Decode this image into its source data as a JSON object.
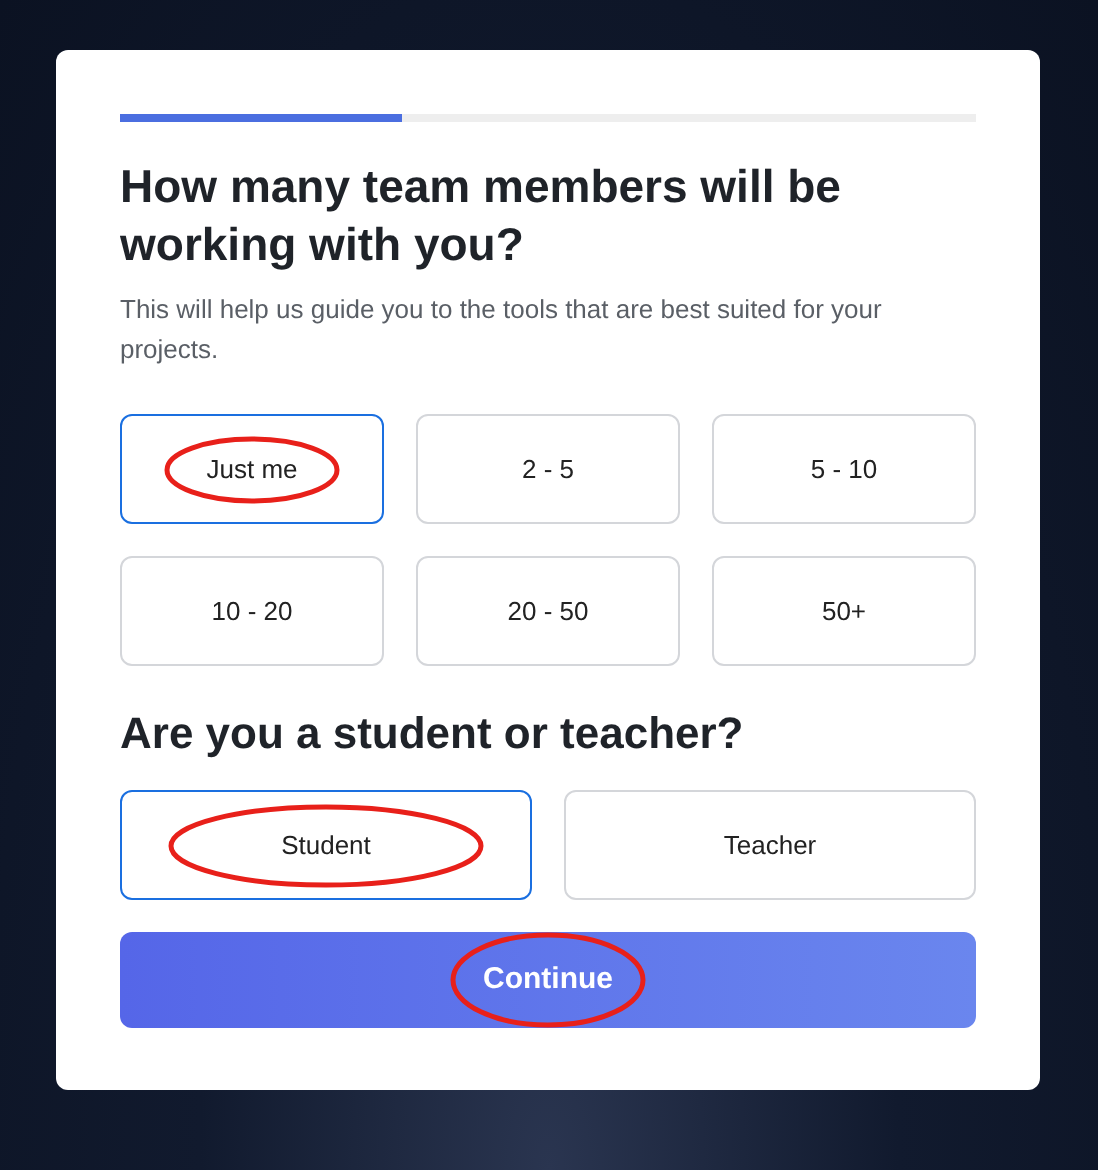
{
  "progress": {
    "level": 0.33
  },
  "question_1": {
    "title": "How many team members will be working with you?",
    "subtitle": "This will help us guide you to the tools that are best suited for your projects.",
    "options": [
      {
        "label": "Just me",
        "selected": true,
        "annotated": true
      },
      {
        "label": "2 - 5",
        "selected": false,
        "annotated": false
      },
      {
        "label": "5 - 10",
        "selected": false,
        "annotated": false
      },
      {
        "label": "10 - 20",
        "selected": false,
        "annotated": false
      },
      {
        "label": "20 - 50",
        "selected": false,
        "annotated": false
      },
      {
        "label": "50+",
        "selected": false,
        "annotated": false
      }
    ]
  },
  "question_2": {
    "title": "Are you a student or teacher?",
    "options": [
      {
        "label": "Student",
        "selected": true,
        "annotated": true
      },
      {
        "label": "Teacher",
        "selected": false,
        "annotated": false
      }
    ]
  },
  "continue_button": {
    "label": "Continue",
    "annotated": true
  }
}
